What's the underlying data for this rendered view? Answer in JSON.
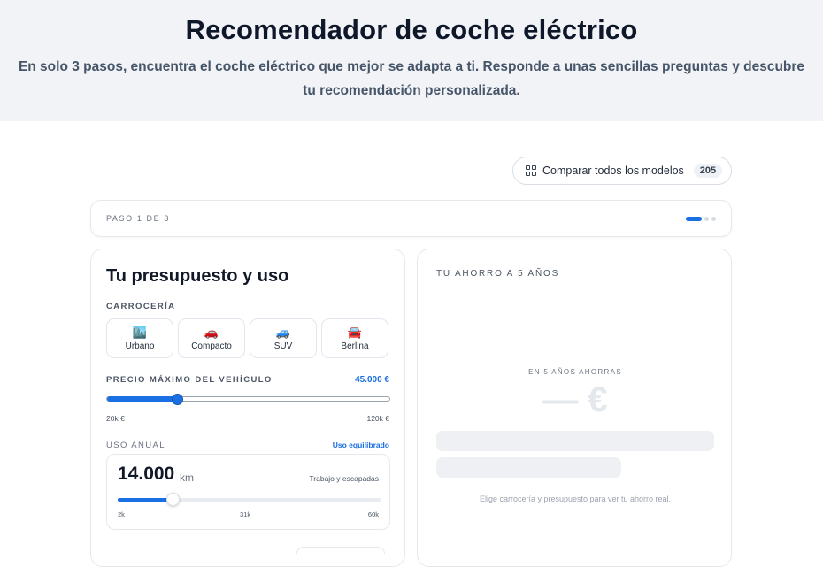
{
  "hero": {
    "title": "Recomendador de coche eléctrico",
    "subtitle": "En solo 3 pasos, encuentra el coche eléctrico que mejor se adapta a ti. Responde a unas sencillas preguntas y descubre tu recomendación personalizada."
  },
  "compare": {
    "icon": "grid-icon",
    "label": "Comparar todos los modelos",
    "count": "205"
  },
  "steps": {
    "label": "PASO 1 DE 3",
    "current": 1,
    "total": 3
  },
  "budget_card": {
    "title": "Tu presupuesto y uso",
    "body_label": "CARROCERÍA",
    "body_types": [
      {
        "icon": "🏙️",
        "label": "Urbano"
      },
      {
        "icon": "🚗",
        "label": "Compacto"
      },
      {
        "icon": "🚙",
        "label": "SUV"
      },
      {
        "icon": "🚘",
        "label": "Berlina"
      }
    ],
    "price": {
      "label": "PRECIO MÁXIMO DEL VEHÍCULO",
      "value": "45.000 €",
      "min_label": "20k €",
      "max_label": "120k €",
      "fraction": 0.25
    },
    "usage": {
      "label": "USO ANUAL",
      "profile": "Uso equilibrado",
      "km": "14.000",
      "unit": "km",
      "note": "Trabajo y escapadas",
      "ticks": [
        "2k",
        "31k",
        "60k"
      ],
      "fraction": 0.21
    }
  },
  "savings_card": {
    "title": "TU AHORRO A 5 AÑOS",
    "savings_label": "EN 5 AÑOS AHORRAS",
    "savings_value": "— €",
    "hint": "Elige carrocería y presupuesto para ver tu ahorro real."
  },
  "colors": {
    "accent": "#1a6fe3",
    "hero_bg": "#f1f3f6",
    "border": "#e5e8ed"
  }
}
